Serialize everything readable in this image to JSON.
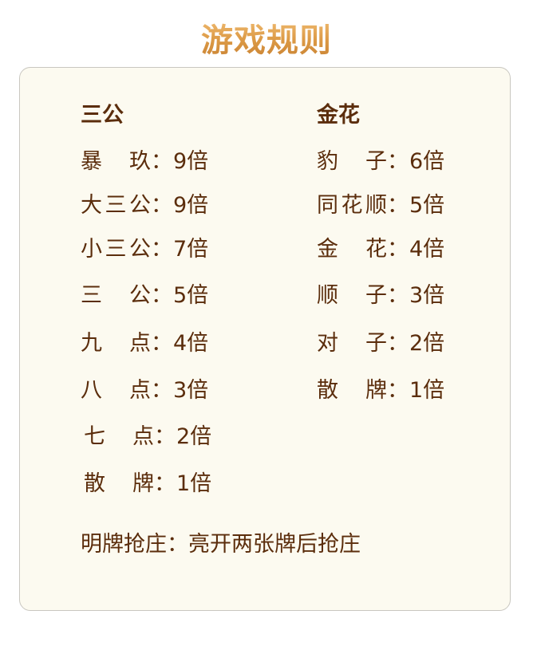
{
  "title": "游戏规则",
  "left": {
    "heading": "三公",
    "rows": [
      {
        "name": "暴  玖",
        "sep": "：",
        "value": "9倍"
      },
      {
        "name": "大三公",
        "sep": "：",
        "value": "9倍"
      },
      {
        "name": "小三公",
        "sep": "：",
        "value": "7倍"
      },
      {
        "name": "三  公",
        "sep": "：",
        "value": "5倍"
      },
      {
        "name": "九  点",
        "sep": "：",
        "value": "4倍"
      },
      {
        "name": "八  点",
        "sep": "：",
        "value": "3倍"
      },
      {
        "name": "七  点",
        "sep": "：",
        "value": "2倍"
      },
      {
        "name": "散  牌",
        "sep": "：",
        "value": "1倍"
      }
    ]
  },
  "right": {
    "heading": "金花",
    "rows": [
      {
        "name": "豹  子",
        "sep": "：",
        "value": "6倍"
      },
      {
        "name": "同花顺",
        "sep": "：",
        "value": "5倍"
      },
      {
        "name": "金  花",
        "sep": "：",
        "value": "4倍"
      },
      {
        "name": "顺  子",
        "sep": "：",
        "value": "3倍"
      },
      {
        "name": "对  子",
        "sep": "：",
        "value": "2倍"
      },
      {
        "name": "散  牌",
        "sep": "：",
        "value": "1倍"
      }
    ]
  },
  "footer": "明牌抢庄：亮开两张牌后抢庄"
}
